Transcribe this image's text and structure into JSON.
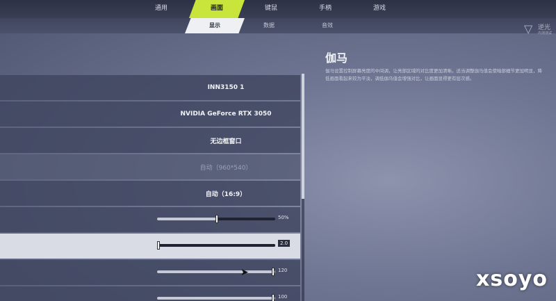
{
  "nav": {
    "tabs": [
      {
        "label": "通用",
        "active": false
      },
      {
        "label": "画面",
        "active": true
      },
      {
        "label": "键鼠",
        "active": false
      },
      {
        "label": "手柄",
        "active": false
      },
      {
        "label": "游戏",
        "active": false
      }
    ],
    "subtabs": [
      {
        "label": "显示",
        "active": true
      },
      {
        "label": "数据",
        "active": false
      },
      {
        "label": "音效",
        "active": false
      }
    ]
  },
  "logo": {
    "line1": "逆光",
    "line2": "内测测试"
  },
  "settings": {
    "rows": [
      {
        "value": "INN3150 1"
      },
      {
        "value": "NVIDIA GeForce RTX 3050"
      },
      {
        "value": "无边框窗口"
      },
      {
        "value": "自动（960*540）",
        "disabled": true
      },
      {
        "value": "自动（16:9）"
      }
    ],
    "sliders": [
      {
        "value_label": "50%",
        "fraction": 0.5
      },
      {
        "value_label": "2.0",
        "fraction": 0.0
      },
      {
        "value_label": "120",
        "fraction": 1.0
      },
      {
        "value_label": "100",
        "fraction": 1.0
      }
    ]
  },
  "description": {
    "title": "伽马",
    "text": "伽马设置控制屏幕亮度的中间调，让亮部区域的对比度更加清晰。适当调整伽马值会使暗部细节更加明显，降低画面看起来较为平淡，调低伽马值会增强对比，让画面显得更有层次感。"
  },
  "watermark": "xsoyo",
  "colors": {
    "accent": "#c9e43b",
    "panel": "#40465f"
  }
}
